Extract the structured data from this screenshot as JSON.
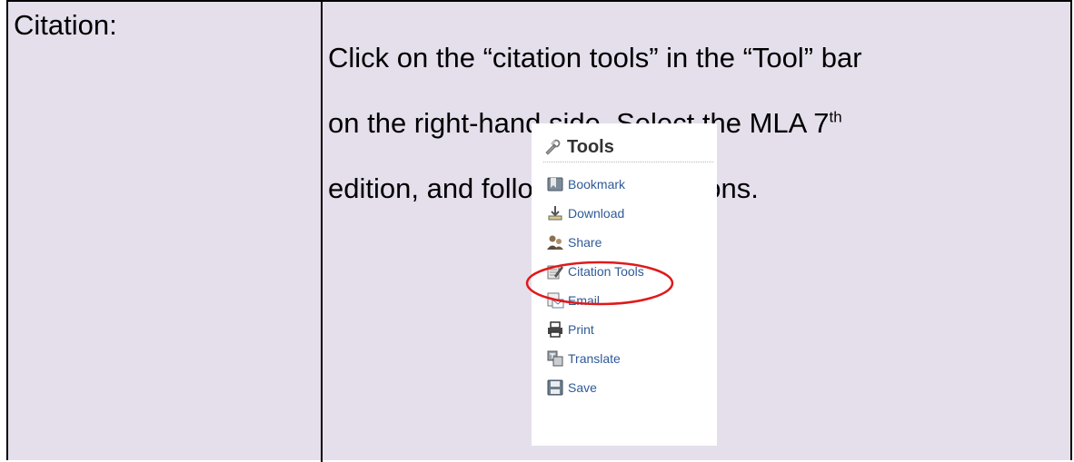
{
  "row": {
    "label": "Citation:",
    "instruction_line1": "Click on the “citation tools” in the “Tool” bar",
    "instruction_line2": "on the right-hand side.  Select the MLA 7",
    "instruction_sup": "th",
    "instruction_line3": "edition, and follow the instructions."
  },
  "tools_panel": {
    "title": "Tools",
    "title_icon": "tools-icon",
    "items": [
      {
        "label": "Bookmark",
        "icon": "bookmark-icon"
      },
      {
        "label": "Download",
        "icon": "download-icon"
      },
      {
        "label": "Share",
        "icon": "share-icon"
      },
      {
        "label": "Citation Tools",
        "icon": "citation-tools-icon"
      },
      {
        "label": "Email",
        "icon": "email-icon"
      },
      {
        "label": "Print",
        "icon": "print-icon"
      },
      {
        "label": "Translate",
        "icon": "translate-icon"
      },
      {
        "label": "Save",
        "icon": "save-icon"
      }
    ],
    "highlighted_item": "Citation Tools"
  },
  "colors": {
    "cell_background": "#e5dfec",
    "link": "#2f5a97",
    "highlight": "#e0191b"
  }
}
